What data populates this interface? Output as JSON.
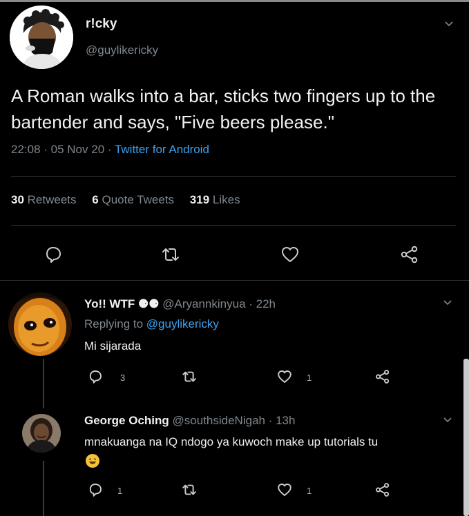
{
  "tweet": {
    "name": "r!cky",
    "handle": "@guylikericky",
    "text": "A Roman walks into a bar, sticks two fingers up to the bartender and says, \"Five beers please.\"",
    "time": "22:08 · 05 Nov 20 · ",
    "source": "Twitter for Android",
    "retweets_count": "30",
    "retweets_label": "Retweets",
    "quotes_count": "6",
    "quotes_label": "Quote Tweets",
    "likes_count": "319",
    "likes_label": "Likes"
  },
  "replies": [
    {
      "name": "Yo!! WTF ⚈⚈",
      "handle_time": "@Aryannkinyua · 22h",
      "replying_prefix": "Replying to ",
      "replying_handle": "@guylikericky",
      "text": "Mi sijarada",
      "reply_count": "3",
      "like_count": "1"
    },
    {
      "name": "George Oching",
      "handle_time": "@southsideNigah · 13h",
      "text": "mnakuanga na IQ ndogo ya kuwoch make up tutorials tu",
      "reply_count": "1",
      "like_count": "1"
    }
  ],
  "colors": {
    "background": "#000000",
    "accent": "#3ea2ef",
    "muted": "#7f878e"
  },
  "icons": [
    "chevron-down-icon",
    "reply-icon",
    "retweet-icon",
    "like-icon",
    "share-icon",
    "laughing-emoji"
  ]
}
